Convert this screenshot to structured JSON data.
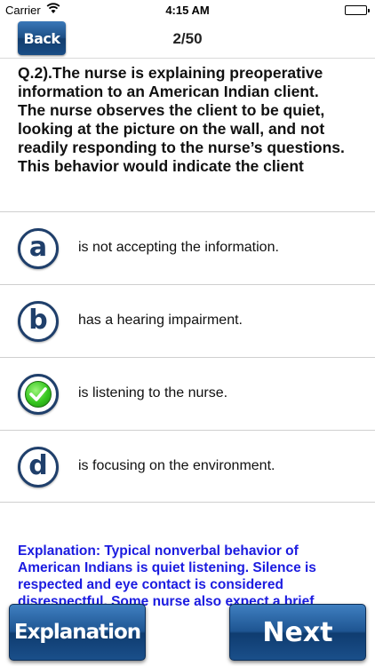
{
  "status_bar": {
    "carrier": "Carrier",
    "time": "4:15 AM"
  },
  "nav": {
    "back_label": "Back",
    "counter": "2/50"
  },
  "question": {
    "lines": [
      "Q.2).The nurse is explaining preoperative",
      "information to an American Indian client.",
      "The nurse observes the client to be quiet,",
      "looking at the picture on the wall, and not",
      "readily responding to the nurse’s questions.",
      "This behavior would indicate the client"
    ]
  },
  "options": [
    {
      "letter": "a",
      "text": "is not accepting the information.",
      "correct": false
    },
    {
      "letter": "b",
      "text": "has a hearing impairment.",
      "correct": false
    },
    {
      "letter": "c",
      "text": "is listening to the nurse.",
      "correct": true
    },
    {
      "letter": "d",
      "text": "is focusing on the environment.",
      "correct": false
    }
  ],
  "explanation": {
    "lines": [
      "Explanation: Typical nonverbal behavior of",
      "American Indians is quiet listening. Silence is",
      "respected and eye contact is considered",
      "disrespectful. Some nurse also expect a brief"
    ]
  },
  "buttons": {
    "explanation_label": "Explanation",
    "next_label": "Next"
  },
  "colors": {
    "accent_blue": "#1d4f86",
    "explanation_text": "#1b1be0",
    "correct_green": "#35c61e"
  }
}
